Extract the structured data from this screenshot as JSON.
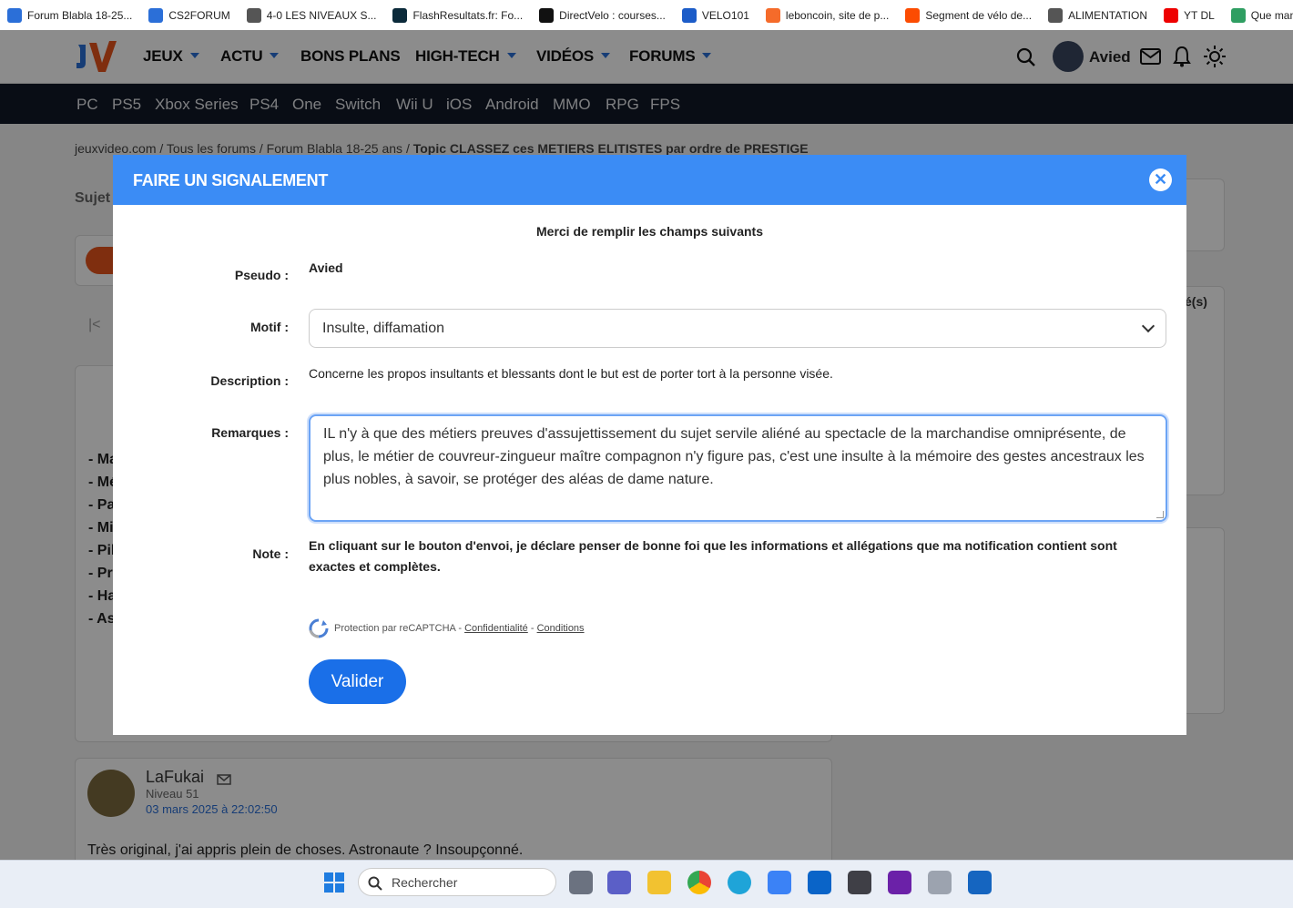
{
  "bookmarks": [
    {
      "label": "Forum Blabla 18-25...",
      "icon": "jv-icon",
      "color": "#2b6fd8"
    },
    {
      "label": "CS2FORUM",
      "icon": "jv-icon",
      "color": "#2b6fd8"
    },
    {
      "label": "4-0 LES NIVEAUX S...",
      "icon": "globe-icon",
      "color": "#555"
    },
    {
      "label": "FlashResultats.fr: Fo...",
      "icon": "flash-icon",
      "color": "#0b2a3a"
    },
    {
      "label": "DirectVelo : courses...",
      "icon": "dv-icon",
      "color": "#111"
    },
    {
      "label": "VELO101",
      "icon": "velo-icon",
      "color": "#1c5cc8"
    },
    {
      "label": "leboncoin, site de p...",
      "icon": "lbc-icon",
      "color": "#f56b2a"
    },
    {
      "label": "Segment de vélo de...",
      "icon": "strava-icon",
      "color": "#fc4c02"
    },
    {
      "label": "ALIMENTATION",
      "icon": "globe-icon",
      "color": "#555"
    },
    {
      "label": "YT DL",
      "icon": "youtube-icon",
      "color": "#e00"
    },
    {
      "label": "Que manger pou",
      "icon": "n-icon",
      "color": "#2f9e62"
    }
  ],
  "nav": {
    "items": [
      "JEUX",
      "ACTU",
      "BONS PLANS",
      "HIGH-TECH",
      "VIDÉOS",
      "FORUMS"
    ],
    "user": "Avied"
  },
  "subnav": [
    "PC",
    "PS5",
    "Xbox Series",
    "PS4",
    "One",
    "Switch",
    "Wii U",
    "iOS",
    "Android",
    "MMO",
    "RPG",
    "FPS"
  ],
  "breadcrumb": {
    "parts": [
      "jeuxvideo.com",
      "Tous les forums",
      "Forum Blabla 18-25 ans"
    ],
    "topic": "Topic CLASSEZ ces METIERS ELITISTES par ordre de PRESTIGE"
  },
  "background": {
    "sujet_label": "Sujet",
    "list_items": [
      "- Ma",
      "- Mé",
      "- Pa",
      "- Mi",
      "- Pil",
      "- Pro",
      "- Ha",
      "- As"
    ],
    "side_label": "é(s)",
    "post": {
      "author": "LaFukai",
      "level": "Niveau 51",
      "date": "03 mars 2025 à 22:02:50",
      "text": "Très original, j'ai appris plein de choses. Astronaute ? Insoupçonné."
    }
  },
  "modal": {
    "title": "FAIRE UN SIGNALEMENT",
    "intro": "Merci de remplir les champs suivants",
    "pseudo_label": "Pseudo :",
    "pseudo_value": "Avied",
    "motif_label": "Motif :",
    "motif_value": "Insulte, diffamation",
    "description_label": "Description :",
    "description_value": "Concerne les propos insultants et blessants dont le but est de porter tort à la personne visée.",
    "remarques_label": "Remarques :",
    "remarques_value": "IL n'y à que des métiers preuves d'assujettissement du sujet servile aliéné au spectacle de la marchandise omniprésente, de plus, le métier de couvreur-zingueur maître compagnon n'y figure pas, c'est une insulte à la mémoire des gestes ancestraux les plus nobles, à savoir, se protéger des aléas de dame nature.",
    "note_label": "Note :",
    "note_value": "En cliquant sur le bouton d'envoi, je déclare penser de bonne foi que les informations et allégations que ma notification contient sont exactes et complètes.",
    "recaptcha_text": "Protection par reCAPTCHA -",
    "privacy_link": "Confidentialité",
    "separator": "-",
    "terms_link": "Conditions",
    "submit_label": "Valider"
  },
  "taskbar": {
    "search_placeholder": "Rechercher"
  }
}
